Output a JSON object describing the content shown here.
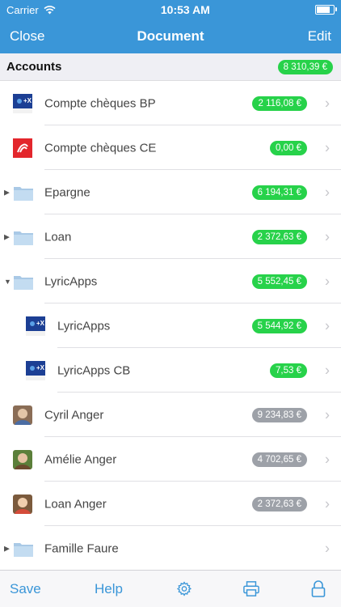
{
  "status": {
    "carrier": "Carrier",
    "time": "10:53 AM"
  },
  "nav": {
    "left": "Close",
    "title": "Document",
    "right": "Edit"
  },
  "section": {
    "title": "Accounts",
    "total": "8 310,39 €"
  },
  "rows": [
    {
      "label": "Compte chèques BP",
      "amount": "2 116,08 €",
      "badge": "green",
      "icon": "bank-bp-icon",
      "level": 0,
      "disclosure": ""
    },
    {
      "label": "Compte chèques CE",
      "amount": "0,00 €",
      "badge": "green",
      "icon": "bank-ce-icon",
      "level": 0,
      "disclosure": ""
    },
    {
      "label": "Epargne",
      "amount": "6 194,31 €",
      "badge": "green",
      "icon": "folder-icon",
      "level": 0,
      "disclosure": "collapsed"
    },
    {
      "label": "Loan",
      "amount": "2 372,63 €",
      "badge": "green",
      "icon": "folder-icon",
      "level": 0,
      "disclosure": "collapsed"
    },
    {
      "label": "LyricApps",
      "amount": "5 552,45 €",
      "badge": "green",
      "icon": "folder-icon",
      "level": 0,
      "disclosure": "expanded"
    },
    {
      "label": "LyricApps",
      "amount": "5 544,92 €",
      "badge": "green",
      "icon": "bank-bp-icon",
      "level": 1,
      "disclosure": ""
    },
    {
      "label": "LyricApps CB",
      "amount": "7,53 €",
      "badge": "green",
      "icon": "bank-bp-icon",
      "level": 1,
      "disclosure": ""
    },
    {
      "label": "Cyril Anger",
      "amount": "9 234,83 €",
      "badge": "gray",
      "icon": "avatar-cyril",
      "level": 0,
      "disclosure": ""
    },
    {
      "label": "Amélie Anger",
      "amount": "4 702,65 €",
      "badge": "gray",
      "icon": "avatar-amelie",
      "level": 0,
      "disclosure": ""
    },
    {
      "label": "Loan Anger",
      "amount": "2 372,63 €",
      "badge": "gray",
      "icon": "avatar-loan",
      "level": 0,
      "disclosure": ""
    },
    {
      "label": "Famille Faure",
      "amount": "",
      "badge": "",
      "icon": "folder-icon",
      "level": 0,
      "disclosure": "collapsed"
    }
  ],
  "tabbar": {
    "save": "Save",
    "help": "Help",
    "settings_icon": "gear-icon",
    "print_icon": "printer-icon",
    "lock_icon": "lock-icon"
  },
  "colors": {
    "accent": "#3a96d8",
    "badge_green": "#27d24a",
    "badge_gray": "#9da1a8"
  }
}
